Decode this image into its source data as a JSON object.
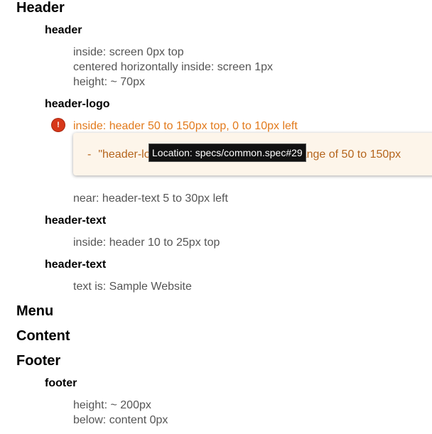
{
  "sections": {
    "header": "Header",
    "menu": "Menu",
    "content": "Content",
    "footer": "Footer"
  },
  "objects": {
    "header": "header",
    "header_logo": "header-logo",
    "header_text_1": "header-text",
    "header_text_2": "header-text",
    "footer": "footer"
  },
  "specs": {
    "header_inside": "inside: screen 0px top",
    "header_centered": "centered horizontally inside: screen 1px",
    "header_height": "height: ~ 70px",
    "logo_inside": "inside: header 50 to 150px top, 0 to 10px left",
    "logo_near": "near: header-text 5 to 30px left",
    "text_inside": "inside: header 10 to 25px top",
    "text_is": "text is: Sample Website",
    "footer_height": "height: ~ 200px",
    "footer_below": "below: content 0px"
  },
  "error": {
    "icon": "exclamation-icon",
    "icon_glyph": "!",
    "bullet": "-",
    "message": "\"header-logo\" is 0px top which is not in range of 50 to 150px"
  },
  "tooltip": {
    "text": "Location: specs/common.spec#29"
  },
  "colors": {
    "failed_spec": "#e27a1c",
    "error_icon": "#d7381a",
    "error_box_bg": "#fdf5ea",
    "tooltip_bg": "#111111"
  }
}
